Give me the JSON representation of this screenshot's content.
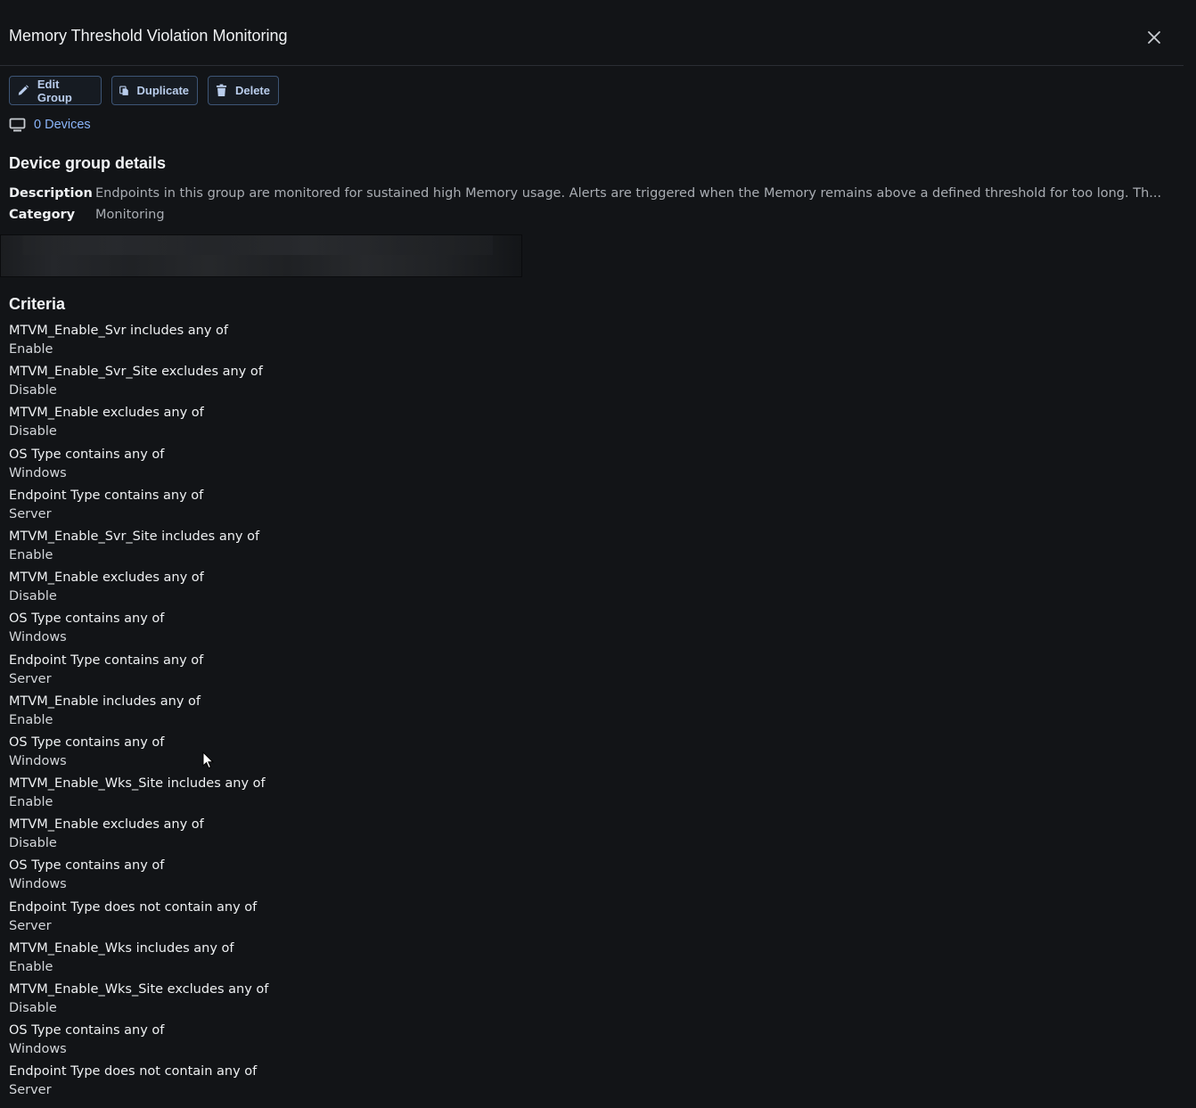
{
  "header": {
    "title": "Memory Threshold Violation Monitoring",
    "close_icon": "close-icon"
  },
  "toolbar": {
    "edit_label": "Edit Group",
    "duplicate_label": "Duplicate",
    "delete_label": "Delete"
  },
  "devices": {
    "label": "0 Devices",
    "icon": "monitor-icon"
  },
  "details": {
    "heading": "Device group details",
    "description_label": "Description",
    "description_value": "Endpoints in this group are monitored for sustained high Memory usage. Alerts are triggered when the Memory remains above a defined threshold for too long. Th...",
    "category_label": "Category",
    "category_value": "Monitoring"
  },
  "criteria": {
    "heading": "Criteria",
    "items": [
      {
        "name": "MTVM_Enable_Svr includes any of",
        "value": "Enable"
      },
      {
        "name": "MTVM_Enable_Svr_Site excludes any of",
        "value": "Disable"
      },
      {
        "name": "MTVM_Enable excludes any of",
        "value": "Disable"
      },
      {
        "name": "OS Type contains any of",
        "value": "Windows"
      },
      {
        "name": "Endpoint Type contains any of",
        "value": "Server"
      },
      {
        "name": "MTVM_Enable_Svr_Site includes any of",
        "value": "Enable"
      },
      {
        "name": "MTVM_Enable excludes any of",
        "value": "Disable"
      },
      {
        "name": "OS Type contains any of",
        "value": "Windows"
      },
      {
        "name": "Endpoint Type contains any of",
        "value": "Server"
      },
      {
        "name": "MTVM_Enable includes any of",
        "value": "Enable"
      },
      {
        "name": "OS Type contains any of",
        "value": "Windows"
      },
      {
        "name": "MTVM_Enable_Wks_Site includes any of",
        "value": "Enable"
      },
      {
        "name": "MTVM_Enable excludes any of",
        "value": "Disable"
      },
      {
        "name": "OS Type contains any of",
        "value": "Windows"
      },
      {
        "name": "Endpoint Type does not contain any of",
        "value": "Server"
      },
      {
        "name": "MTVM_Enable_Wks includes any of",
        "value": "Enable"
      },
      {
        "name": "MTVM_Enable_Wks_Site excludes any of",
        "value": "Disable"
      },
      {
        "name": "OS Type contains any of",
        "value": "Windows"
      },
      {
        "name": "Endpoint Type does not contain any of",
        "value": "Server"
      }
    ]
  },
  "colors": {
    "background": "#121417",
    "accent_link": "#8ab4f8",
    "button_border": "#3d5575"
  }
}
